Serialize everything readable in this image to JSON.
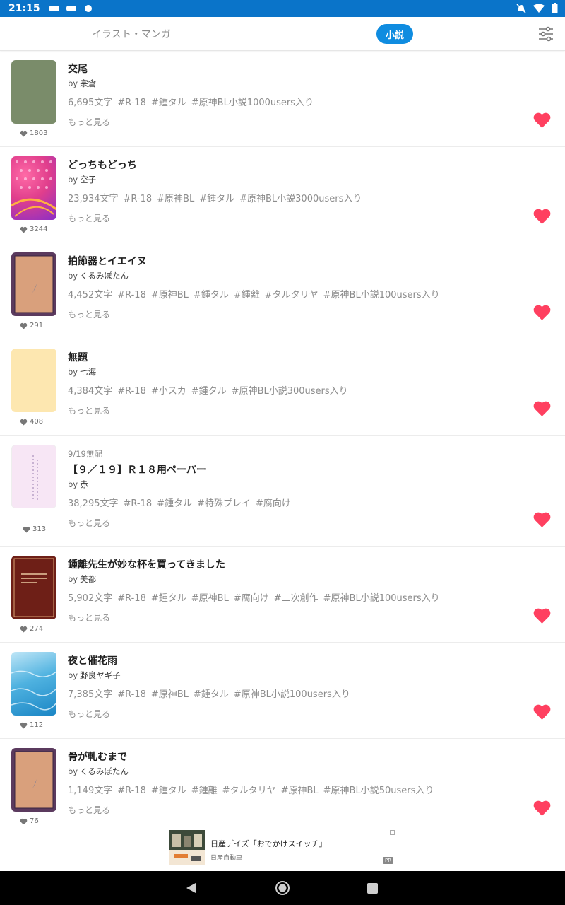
{
  "status_bar": {
    "time": "21:15"
  },
  "tabs": {
    "illust_manga": "イラスト・マンガ",
    "novel": "小説"
  },
  "colors": {
    "accent": "#0f8ce0",
    "heart": "#ff4060",
    "status_bar": "#0a74c9"
  },
  "novels": [
    {
      "title": "交尾",
      "by": "by",
      "author": "宗倉",
      "chars": "6,695文字",
      "tags": [
        "#R-18",
        "#鍾タル",
        "#原神BL小説1000users入り"
      ],
      "more": "もっと見る",
      "likes": "1803"
    },
    {
      "title": "どっちもどっち",
      "by": "by",
      "author": "空子",
      "chars": "23,934文字",
      "tags": [
        "#R-18",
        "#原神BL",
        "#鍾タル",
        "#原神BL小説3000users入り"
      ],
      "more": "もっと見る",
      "likes": "3244"
    },
    {
      "title": "拍節器とイエイヌ",
      "by": "by",
      "author": "くるみぽたん",
      "chars": "4,452文字",
      "tags": [
        "#R-18",
        "#原神BL",
        "#鍾タル",
        "#鍾離",
        "#タルタリヤ",
        "#原神BL小説100users入り"
      ],
      "more": "もっと見る",
      "likes": "291"
    },
    {
      "title": "無題",
      "by": "by",
      "author": "七海",
      "chars": "4,384文字",
      "tags": [
        "#R-18",
        "#小スカ",
        "#鍾タル",
        "#原神BL小説300users入り"
      ],
      "more": "もっと見る",
      "likes": "408"
    },
    {
      "pre": "9/19無配",
      "title": "【９／１９】Ｒ１８用ペーパー",
      "by": "by",
      "author": "赤",
      "chars": "38,295文字",
      "tags": [
        "#R-18",
        "#鍾タル",
        "#特殊プレイ",
        "#腐向け"
      ],
      "more": "もっと見る",
      "likes": "313"
    },
    {
      "title": "鍾離先生が妙な杯を買ってきました",
      "by": "by",
      "author": "美都",
      "chars": "5,902文字",
      "tags": [
        "#R-18",
        "#鍾タル",
        "#原神BL",
        "#腐向け",
        "#二次創作",
        "#原神BL小説100users入り"
      ],
      "more": "もっと見る",
      "likes": "274"
    },
    {
      "title": "夜と催花雨",
      "by": "by",
      "author": "野良ヤギ子",
      "chars": "7,385文字",
      "tags": [
        "#R-18",
        "#原神BL",
        "#鍾タル",
        "#原神BL小説100users入り"
      ],
      "more": "もっと見る",
      "likes": "112"
    },
    {
      "title": "骨が軋むまで",
      "by": "by",
      "author": "くるみぽたん",
      "chars": "1,149文字",
      "tags": [
        "#R-18",
        "#鍾タル",
        "#鍾離",
        "#タルタリヤ",
        "#原神BL",
        "#原神BL小説50users入り"
      ],
      "more": "もっと見る",
      "likes": "76"
    }
  ],
  "ad": {
    "title": "日産デイズ「おでかけスイッチ」",
    "sponsor": "日産自動車",
    "pr": "PR"
  }
}
